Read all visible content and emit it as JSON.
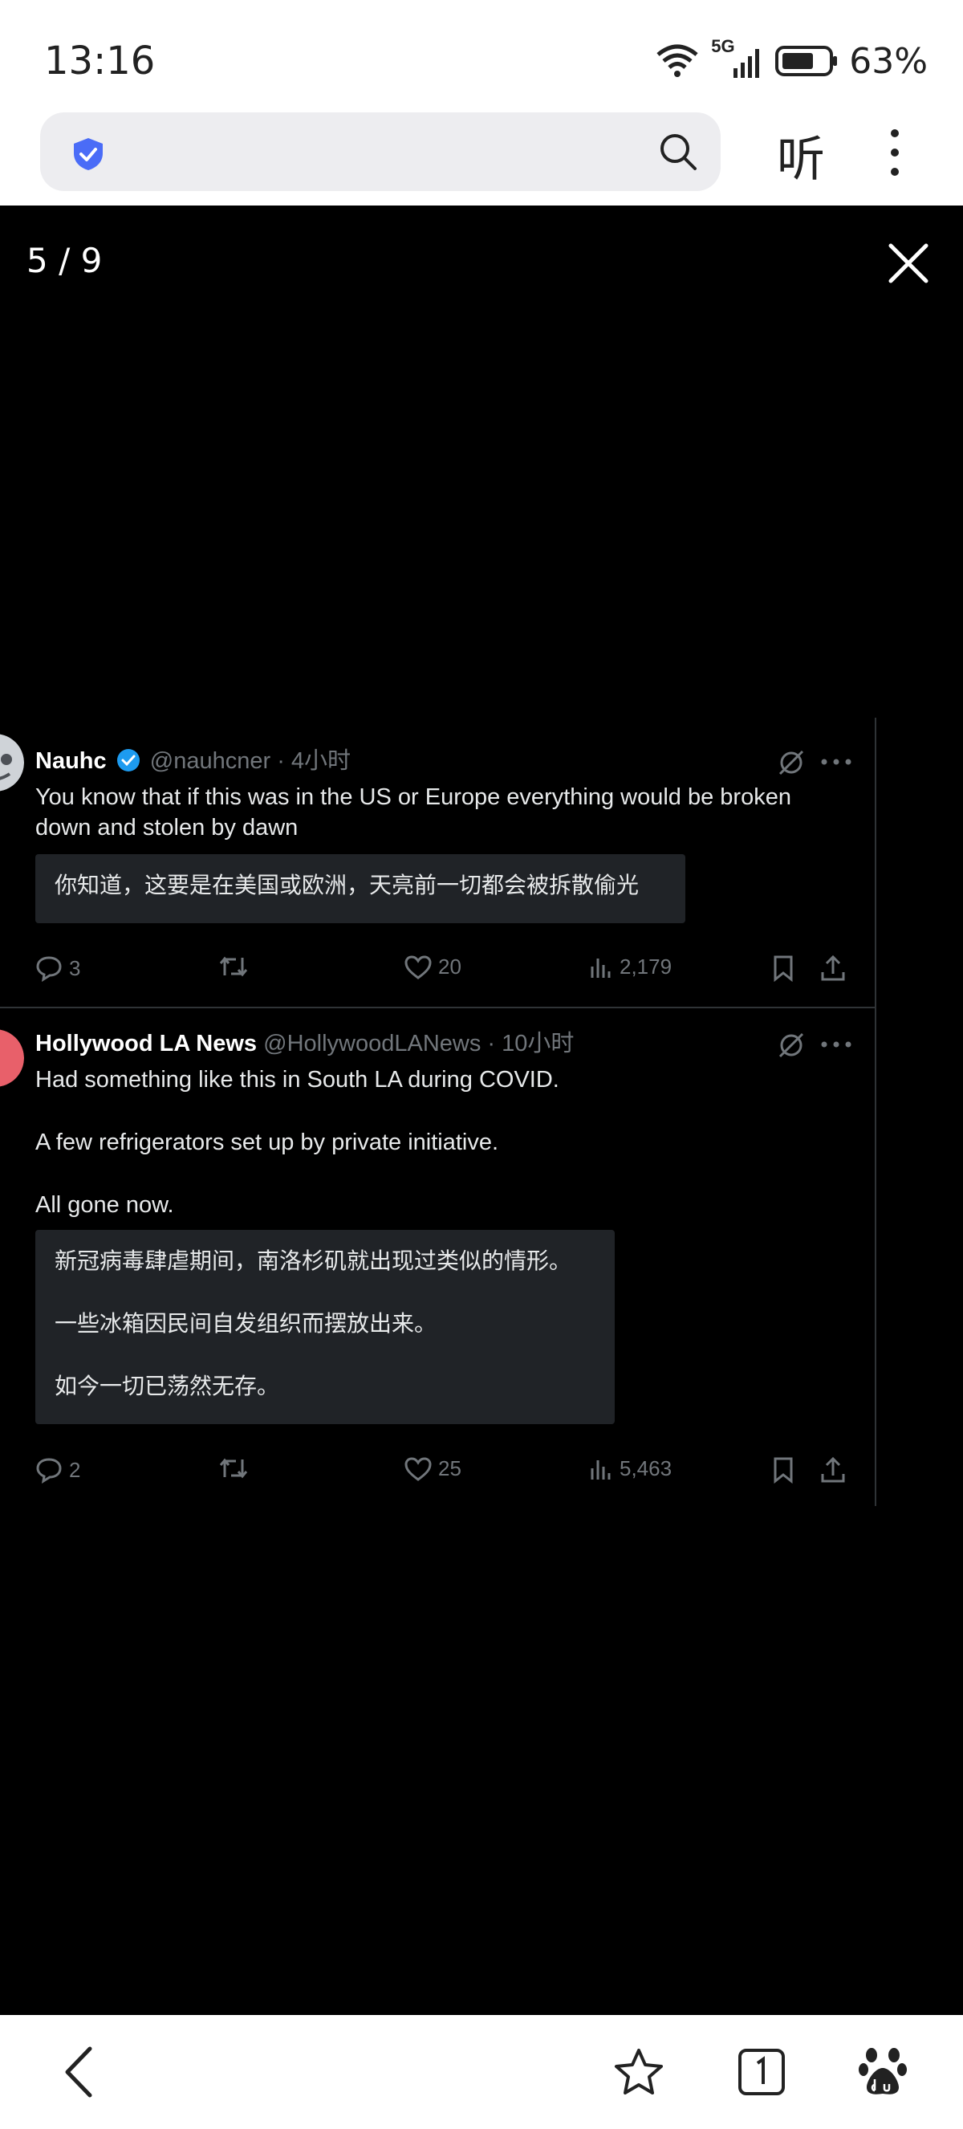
{
  "status": {
    "time": "13:16",
    "network": "5G",
    "battery": "63%"
  },
  "browser": {
    "listen_label": "听"
  },
  "viewer": {
    "counter": "5 / 9"
  },
  "tweets": [
    {
      "name": "Nauhc",
      "handle_time": "@nauhcner · 4小时",
      "text": "You know that if this was in the US or Europe everything would be broken down and stolen by dawn",
      "translation": [
        "你知道，这要是在美国或欧洲，天亮前一切都会被拆散偷光"
      ],
      "replies": "3",
      "likes": "20",
      "views": "2,179"
    },
    {
      "name": "Hollywood LA News",
      "handle_time": "@HollywoodLANews · 10小时",
      "text": [
        "Had something like this in South LA during COVID.",
        "A few refrigerators set up by private initiative.",
        "All gone now."
      ],
      "translation": [
        "新冠病毒肆虐期间，南洛杉矶就出现过类似的情形。",
        "一些冰箱因民间自发组织而摆放出来。",
        "如今一切已荡然无存。"
      ],
      "replies": "2",
      "likes": "25",
      "views": "5,463"
    }
  ],
  "colors": {
    "background": "#000000",
    "muted": "#71767b",
    "verified": "#1d9bf0",
    "translation_bg": "#202327",
    "shield": "#4a6cf7"
  }
}
